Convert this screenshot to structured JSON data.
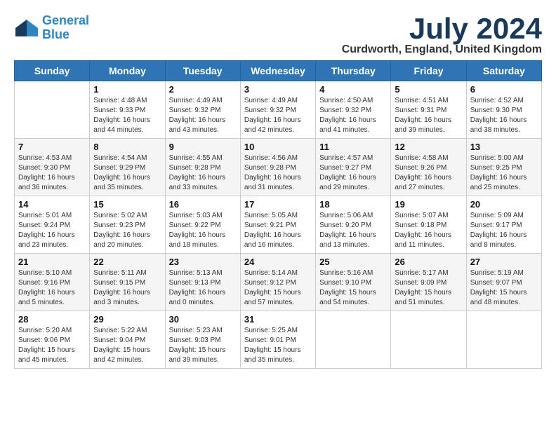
{
  "logo": {
    "line1": "General",
    "line2": "Blue"
  },
  "title": {
    "month": "July 2024",
    "location": "Curdworth, England, United Kingdom"
  },
  "headers": [
    "Sunday",
    "Monday",
    "Tuesday",
    "Wednesday",
    "Thursday",
    "Friday",
    "Saturday"
  ],
  "weeks": [
    [
      {
        "day": "",
        "info": ""
      },
      {
        "day": "1",
        "info": "Sunrise: 4:48 AM\nSunset: 9:33 PM\nDaylight: 16 hours\nand 44 minutes."
      },
      {
        "day": "2",
        "info": "Sunrise: 4:49 AM\nSunset: 9:32 PM\nDaylight: 16 hours\nand 43 minutes."
      },
      {
        "day": "3",
        "info": "Sunrise: 4:49 AM\nSunset: 9:32 PM\nDaylight: 16 hours\nand 42 minutes."
      },
      {
        "day": "4",
        "info": "Sunrise: 4:50 AM\nSunset: 9:32 PM\nDaylight: 16 hours\nand 41 minutes."
      },
      {
        "day": "5",
        "info": "Sunrise: 4:51 AM\nSunset: 9:31 PM\nDaylight: 16 hours\nand 39 minutes."
      },
      {
        "day": "6",
        "info": "Sunrise: 4:52 AM\nSunset: 9:30 PM\nDaylight: 16 hours\nand 38 minutes."
      }
    ],
    [
      {
        "day": "7",
        "info": "Sunrise: 4:53 AM\nSunset: 9:30 PM\nDaylight: 16 hours\nand 36 minutes."
      },
      {
        "day": "8",
        "info": "Sunrise: 4:54 AM\nSunset: 9:29 PM\nDaylight: 16 hours\nand 35 minutes."
      },
      {
        "day": "9",
        "info": "Sunrise: 4:55 AM\nSunset: 9:28 PM\nDaylight: 16 hours\nand 33 minutes."
      },
      {
        "day": "10",
        "info": "Sunrise: 4:56 AM\nSunset: 9:28 PM\nDaylight: 16 hours\nand 31 minutes."
      },
      {
        "day": "11",
        "info": "Sunrise: 4:57 AM\nSunset: 9:27 PM\nDaylight: 16 hours\nand 29 minutes."
      },
      {
        "day": "12",
        "info": "Sunrise: 4:58 AM\nSunset: 9:26 PM\nDaylight: 16 hours\nand 27 minutes."
      },
      {
        "day": "13",
        "info": "Sunrise: 5:00 AM\nSunset: 9:25 PM\nDaylight: 16 hours\nand 25 minutes."
      }
    ],
    [
      {
        "day": "14",
        "info": "Sunrise: 5:01 AM\nSunset: 9:24 PM\nDaylight: 16 hours\nand 23 minutes."
      },
      {
        "day": "15",
        "info": "Sunrise: 5:02 AM\nSunset: 9:23 PM\nDaylight: 16 hours\nand 20 minutes."
      },
      {
        "day": "16",
        "info": "Sunrise: 5:03 AM\nSunset: 9:22 PM\nDaylight: 16 hours\nand 18 minutes."
      },
      {
        "day": "17",
        "info": "Sunrise: 5:05 AM\nSunset: 9:21 PM\nDaylight: 16 hours\nand 16 minutes."
      },
      {
        "day": "18",
        "info": "Sunrise: 5:06 AM\nSunset: 9:20 PM\nDaylight: 16 hours\nand 13 minutes."
      },
      {
        "day": "19",
        "info": "Sunrise: 5:07 AM\nSunset: 9:18 PM\nDaylight: 16 hours\nand 11 minutes."
      },
      {
        "day": "20",
        "info": "Sunrise: 5:09 AM\nSunset: 9:17 PM\nDaylight: 16 hours\nand 8 minutes."
      }
    ],
    [
      {
        "day": "21",
        "info": "Sunrise: 5:10 AM\nSunset: 9:16 PM\nDaylight: 16 hours\nand 5 minutes."
      },
      {
        "day": "22",
        "info": "Sunrise: 5:11 AM\nSunset: 9:15 PM\nDaylight: 16 hours\nand 3 minutes."
      },
      {
        "day": "23",
        "info": "Sunrise: 5:13 AM\nSunset: 9:13 PM\nDaylight: 16 hours\nand 0 minutes."
      },
      {
        "day": "24",
        "info": "Sunrise: 5:14 AM\nSunset: 9:12 PM\nDaylight: 15 hours\nand 57 minutes."
      },
      {
        "day": "25",
        "info": "Sunrise: 5:16 AM\nSunset: 9:10 PM\nDaylight: 15 hours\nand 54 minutes."
      },
      {
        "day": "26",
        "info": "Sunrise: 5:17 AM\nSunset: 9:09 PM\nDaylight: 15 hours\nand 51 minutes."
      },
      {
        "day": "27",
        "info": "Sunrise: 5:19 AM\nSunset: 9:07 PM\nDaylight: 15 hours\nand 48 minutes."
      }
    ],
    [
      {
        "day": "28",
        "info": "Sunrise: 5:20 AM\nSunset: 9:06 PM\nDaylight: 15 hours\nand 45 minutes."
      },
      {
        "day": "29",
        "info": "Sunrise: 5:22 AM\nSunset: 9:04 PM\nDaylight: 15 hours\nand 42 minutes."
      },
      {
        "day": "30",
        "info": "Sunrise: 5:23 AM\nSunset: 9:03 PM\nDaylight: 15 hours\nand 39 minutes."
      },
      {
        "day": "31",
        "info": "Sunrise: 5:25 AM\nSunset: 9:01 PM\nDaylight: 15 hours\nand 35 minutes."
      },
      {
        "day": "",
        "info": ""
      },
      {
        "day": "",
        "info": ""
      },
      {
        "day": "",
        "info": ""
      }
    ]
  ]
}
